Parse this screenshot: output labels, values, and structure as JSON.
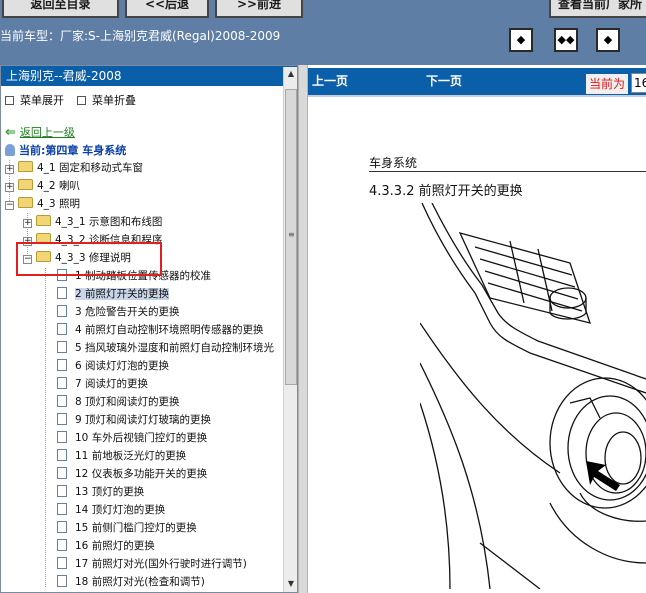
{
  "toolbar": {
    "home_label": "返回至目录",
    "back_label": "<<后退",
    "forward_label": ">>前进",
    "current_label": "查看当前厂家所"
  },
  "vehicle": {
    "label": "当前车型：厂家:S-上海别克君威(Regal)2008-2009"
  },
  "view_buttons": [
    "◆",
    "◆◆",
    "◆"
  ],
  "left_pane": {
    "title": "上海别克--君威-2008",
    "expand_label": "菜单展开",
    "collapse_label": "菜单折叠",
    "back_link": "返回上一级",
    "current_chapter": "当前:第四章  车身系统",
    "tree": [
      {
        "label": "4_1 固定和移动式车窗",
        "level": 0,
        "type": "folder",
        "expanded": false
      },
      {
        "label": "4_2 喇叭",
        "level": 0,
        "type": "folder",
        "expanded": false
      },
      {
        "label": "4_3 照明",
        "level": 0,
        "type": "folder",
        "expanded": true
      },
      {
        "label": "4_3_1 示意图和布线图",
        "level": 1,
        "type": "folder",
        "expanded": false
      },
      {
        "label": "4_3_2 诊断信息和程序",
        "level": 1,
        "type": "folder",
        "expanded": false
      },
      {
        "label": "4_3_3 修理说明",
        "level": 1,
        "type": "folder",
        "expanded": true
      },
      {
        "label": "1 制动踏板位置传感器的校准",
        "level": 2,
        "type": "page"
      },
      {
        "label": "2 前照灯开关的更换",
        "level": 2,
        "type": "page",
        "selected": true
      },
      {
        "label": "3 危险警告开关的更换",
        "level": 2,
        "type": "page"
      },
      {
        "label": "4 前照灯自动控制环境照明传感器的更换",
        "level": 2,
        "type": "page"
      },
      {
        "label": "5 挡风玻璃外湿度和前照灯自动控制环境光",
        "level": 2,
        "type": "page"
      },
      {
        "label": "6 阅读灯灯泡的更换",
        "level": 2,
        "type": "page"
      },
      {
        "label": "7 阅读灯的更换",
        "level": 2,
        "type": "page"
      },
      {
        "label": "8 顶灯和阅读灯的更换",
        "level": 2,
        "type": "page"
      },
      {
        "label": "9 顶灯和阅读灯灯玻璃的更换",
        "level": 2,
        "type": "page"
      },
      {
        "label": "10 车外后视镜门控灯的更换",
        "level": 2,
        "type": "page"
      },
      {
        "label": "11 前地板泛光灯的更换",
        "level": 2,
        "type": "page"
      },
      {
        "label": "12 仪表板多功能开关的更换",
        "level": 2,
        "type": "page"
      },
      {
        "label": "13 顶灯的更换",
        "level": 2,
        "type": "page"
      },
      {
        "label": "14 顶灯灯泡的更换",
        "level": 2,
        "type": "page"
      },
      {
        "label": "15 前侧门槛门控灯的更换",
        "level": 2,
        "type": "page"
      },
      {
        "label": "16 前照灯的更换",
        "level": 2,
        "type": "page"
      },
      {
        "label": "17 前照灯对光(国外行驶时进行调节)",
        "level": 2,
        "type": "page"
      },
      {
        "label": "18 前照灯对光(检查和调节)",
        "level": 2,
        "type": "page"
      }
    ]
  },
  "right_pane": {
    "prev_label": "上一页",
    "next_label": "下一页",
    "current_page_label": "当前为",
    "current_page_value": "16",
    "section_title": "车身系统",
    "procedure_title": "4.3.3.2 前照灯开关的更换"
  }
}
